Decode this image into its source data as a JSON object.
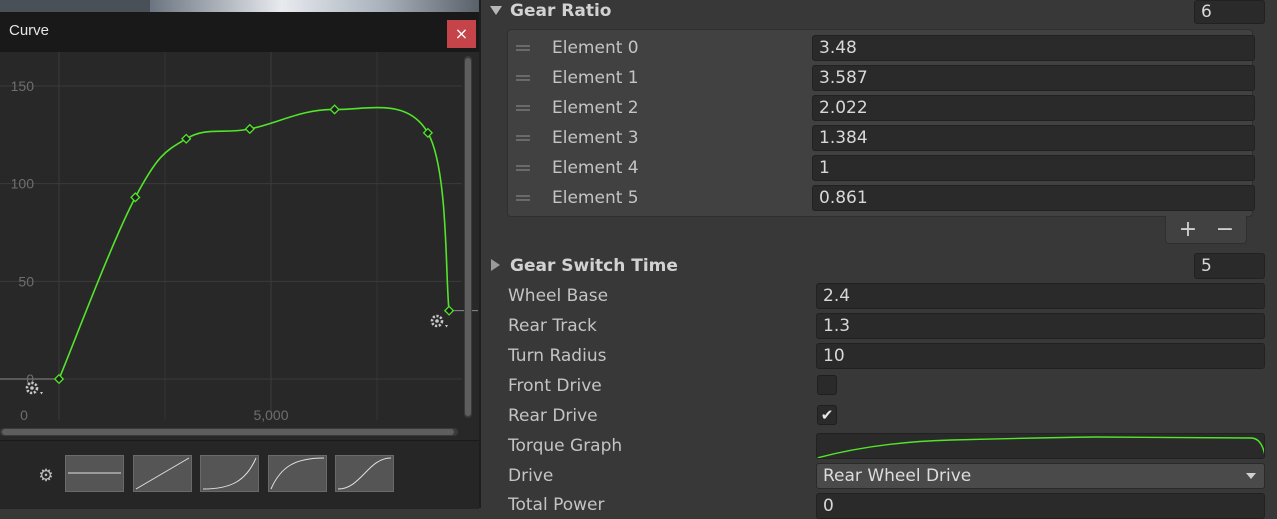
{
  "curve_window": {
    "title": "Curve",
    "close_glyph": "×",
    "y_ticks": [
      "150",
      "100",
      "50",
      "0"
    ],
    "x_ticks": [
      "0",
      "5,000"
    ],
    "keyframes": [
      {
        "x": 0,
        "y": 0
      },
      {
        "x": 1800,
        "y": 93
      },
      {
        "x": 3000,
        "y": 123
      },
      {
        "x": 4500,
        "y": 128
      },
      {
        "x": 6500,
        "y": 138
      },
      {
        "x": 8700,
        "y": 126
      },
      {
        "x": 9200,
        "y": 35
      }
    ],
    "curve_color": "#52e52a",
    "presets": [
      "constant",
      "linear",
      "ease-in",
      "ease-out",
      "ease-in-out"
    ]
  },
  "inspector": {
    "gear_ratio": {
      "label": "Gear Ratio",
      "size": "6",
      "elements": [
        {
          "label": "Element 0",
          "value": "3.48"
        },
        {
          "label": "Element 1",
          "value": "3.587"
        },
        {
          "label": "Element 2",
          "value": "2.022"
        },
        {
          "label": "Element 3",
          "value": "1.384"
        },
        {
          "label": "Element 4",
          "value": "1"
        },
        {
          "label": "Element 5",
          "value": "0.861"
        }
      ],
      "add_label": "+",
      "remove_label": "−"
    },
    "gear_switch_time": {
      "label": "Gear Switch Time",
      "value": "5"
    },
    "wheel_base": {
      "label": "Wheel Base",
      "value": "2.4"
    },
    "rear_track": {
      "label": "Rear Track",
      "value": "1.3"
    },
    "turn_radius": {
      "label": "Turn Radius",
      "value": "10"
    },
    "front_drive": {
      "label": "Front Drive",
      "checked": false
    },
    "rear_drive": {
      "label": "Rear Drive",
      "checked": true,
      "check_glyph": "✔"
    },
    "torque_graph": {
      "label": "Torque Graph"
    },
    "drive": {
      "label": "Drive",
      "value": "Rear Wheel Drive"
    },
    "total_power": {
      "label": "Total Power",
      "value": "0"
    }
  }
}
